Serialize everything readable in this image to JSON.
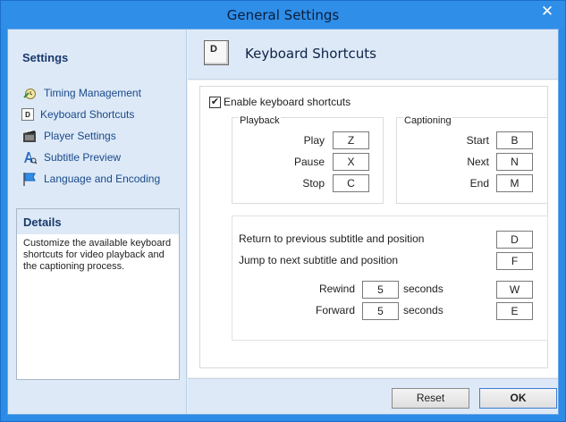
{
  "window": {
    "title": "General Settings",
    "close_glyph": "✕"
  },
  "sidebar": {
    "title": "Settings",
    "items": [
      {
        "label": "Timing Management",
        "icon": "timing-icon"
      },
      {
        "label": "Keyboard Shortcuts",
        "icon": "keyboard-key-icon",
        "glyph": "D"
      },
      {
        "label": "Player Settings",
        "icon": "film-icon"
      },
      {
        "label": "Subtitle Preview",
        "icon": "subtitle-preview-icon"
      },
      {
        "label": "Language and Encoding",
        "icon": "flag-icon"
      }
    ]
  },
  "details": {
    "title": "Details",
    "text": "Customize the available keyboard shortcuts for video playback and the captioning process."
  },
  "header": {
    "title": "Keyboard Shortcuts",
    "key_glyph": "D"
  },
  "enable": {
    "label": "Enable keyboard shortcuts",
    "checked": true,
    "check_glyph": "✔"
  },
  "playback": {
    "title": "Playback",
    "rows": [
      {
        "label": "Play",
        "key": "Z"
      },
      {
        "label": "Pause",
        "key": "X"
      },
      {
        "label": "Stop",
        "key": "C"
      }
    ]
  },
  "captioning": {
    "title": "Captioning",
    "rows": [
      {
        "label": "Start",
        "key": "B"
      },
      {
        "label": "Next",
        "key": "N"
      },
      {
        "label": "End",
        "key": "M"
      }
    ]
  },
  "navigation": {
    "prev_label": "Return to previous subtitle and position",
    "prev_key": "D",
    "next_label": "Jump to next subtitle and position",
    "next_key": "F",
    "rewind_label": "Rewind",
    "rewind_value": "5",
    "rewind_unit": "seconds",
    "rewind_key": "W",
    "forward_label": "Forward",
    "forward_value": "5",
    "forward_unit": "seconds",
    "forward_key": "E"
  },
  "footer": {
    "reset_label": "Reset",
    "ok_label": "OK"
  },
  "colors": {
    "titlebar": "#2f8ee8",
    "sidebar": "#dde9f7",
    "accent_text": "#1a4a8a"
  }
}
